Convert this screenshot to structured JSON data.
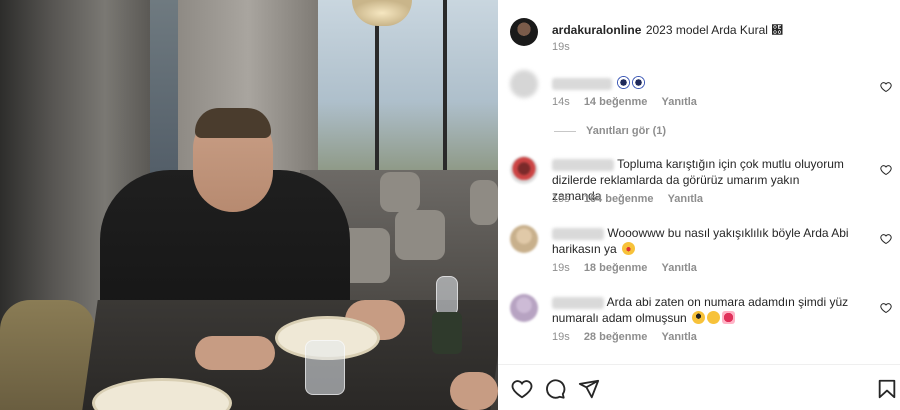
{
  "post": {
    "username": "ardakuralonline",
    "caption": "2023 model Arda Kural ฀",
    "time": "19s"
  },
  "comments": [
    {
      "username": "",
      "text": "",
      "time": "14s",
      "likes": "14 beğenme",
      "reply": "Yanıtla",
      "emoji": [
        "eyes-emoji",
        "eyes-emoji"
      ]
    },
    {
      "username": "",
      "text": "Topluma karıştığın için çok mutlu oluyorum dizilerde reklamlarda da görürüz umarım yakın zamanda",
      "time": "19s",
      "likes": "164 beğenme",
      "reply": "Yanıtla"
    },
    {
      "username": "",
      "text": "Wooowww bu nasıl yakışıklılık böyle Arda Abi harikasın ya",
      "time": "19s",
      "likes": "18 beğenme",
      "reply": "Yanıtla",
      "emoji": [
        "star-struck-emoji"
      ]
    },
    {
      "username": "",
      "text": "Arda abi zaten on numara adamdın şimdi yüz numaralı adam olmuşsun",
      "time": "19s",
      "likes": "28 beğenme",
      "reply": "Yanıtla",
      "emoji": [
        "sunglasses-emoji",
        "smirk-emoji",
        "heart-ribbon-emoji"
      ]
    }
  ],
  "replies_toggle": "Yanıtları gör (1)",
  "actions": [
    "heart-icon",
    "comment-icon",
    "share-icon",
    "bookmark-icon"
  ],
  "colors": {
    "text": "#262626",
    "secondary": "#8e8e8e",
    "border": "#efefef"
  }
}
